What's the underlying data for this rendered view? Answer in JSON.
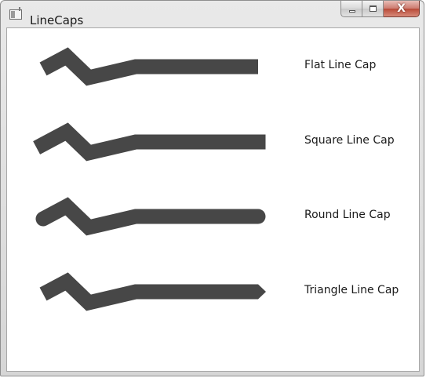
{
  "window": {
    "title": "LineCaps",
    "close_symbol": "X"
  },
  "icons": {
    "app": "window-app-icon",
    "minimize": "minimize-icon",
    "maximize": "maximize-icon",
    "close": "close-icon"
  },
  "colors": {
    "stroke": "#474747",
    "label_text": "#1a1a1a"
  },
  "demos": [
    {
      "cap": "Flat",
      "label": "Flat Line Cap"
    },
    {
      "cap": "Square",
      "label": "Square Line Cap"
    },
    {
      "cap": "Round",
      "label": "Round Line Cap"
    },
    {
      "cap": "Triangle",
      "label": "Triangle Line Cap"
    }
  ]
}
